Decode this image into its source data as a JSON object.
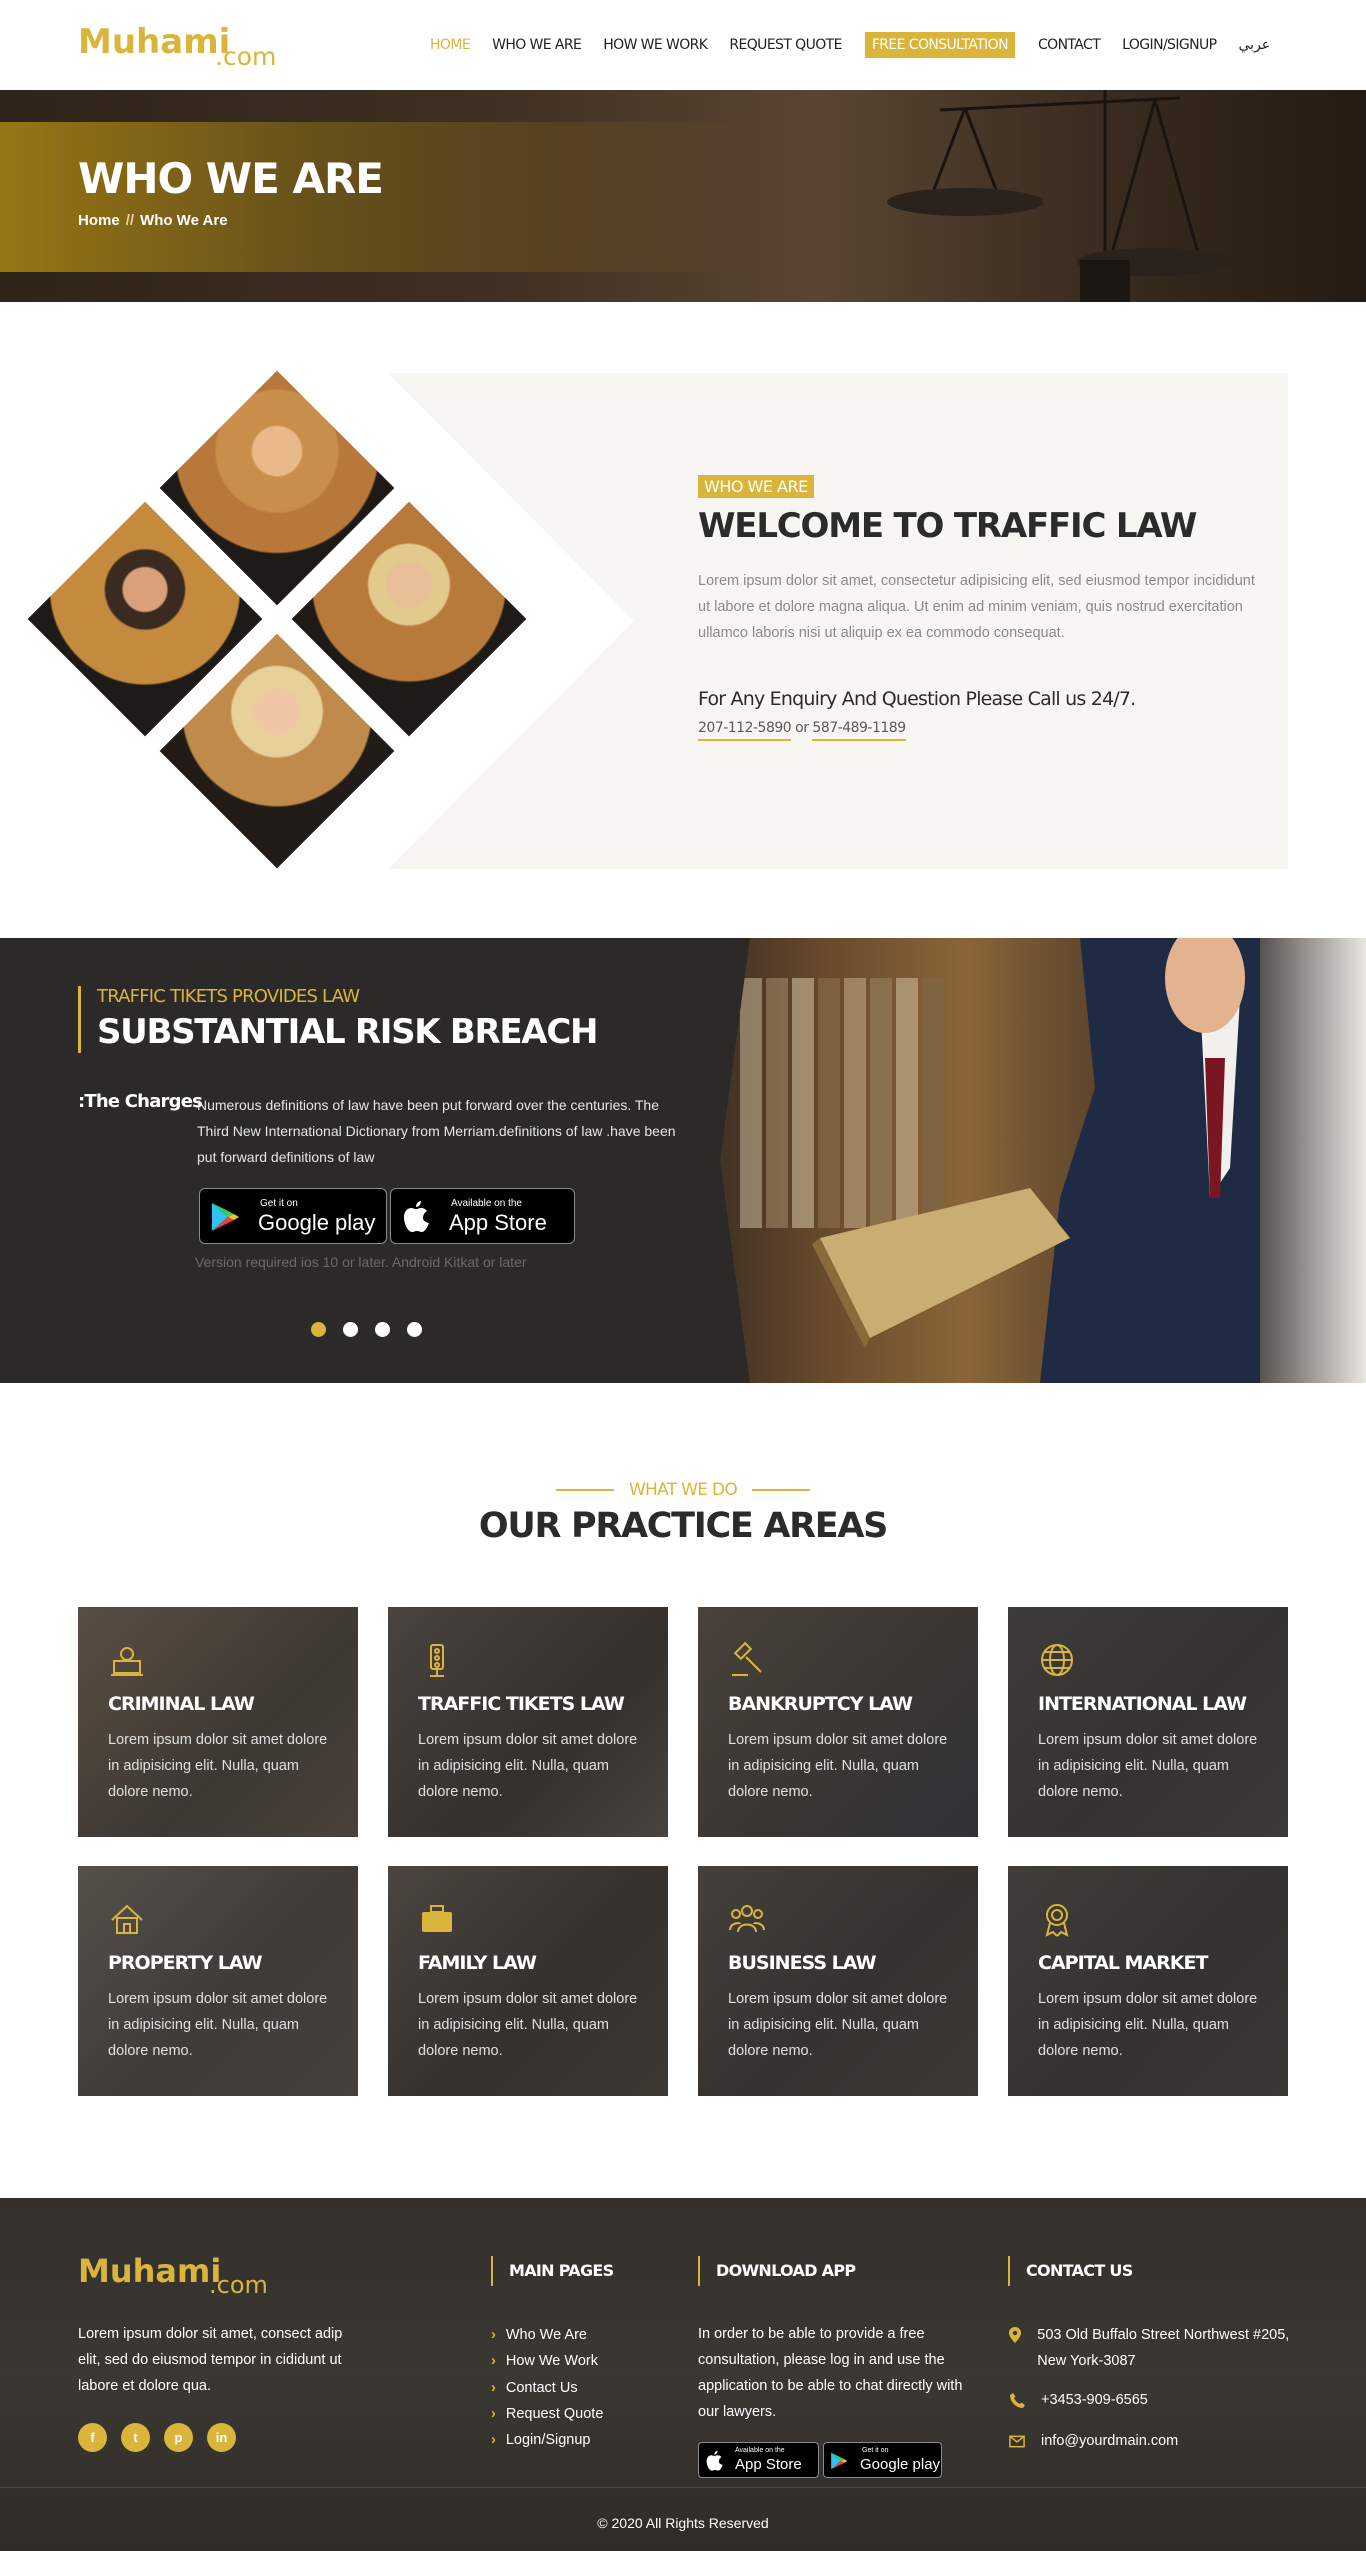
{
  "header": {
    "logo_brand": "Muhami",
    "logo_tld": ".com",
    "nav": [
      {
        "label": "HOME"
      },
      {
        "label": "WHO WE ARE"
      },
      {
        "label": "HOW WE WORK"
      },
      {
        "label": "REQUEST QUOTE"
      },
      {
        "label": "FREE CONSULTATION"
      },
      {
        "label": "CONTACT"
      },
      {
        "label": "LOGIN/SIGNUP"
      },
      {
        "label": "عربي"
      }
    ]
  },
  "hero": {
    "title": "WHO WE ARE",
    "crumb_home": "Home",
    "crumb_sep": "//",
    "crumb_current": "Who We Are"
  },
  "welcome": {
    "tag": "WHO WE ARE",
    "title": "WELCOME TO TRAFFIC LAW",
    "body": "Lorem ipsum dolor sit amet, consectetur adipisicing elit, sed eiusmod tempor incididunt ut labore et dolore magna aliqua. Ut enim ad minim veniam, quis nostrud exercitation ullamco laboris nisi ut aliquip ex ea commodo consequat.",
    "enquiry": "For Any Enquiry And Question Please Call us 24/7.",
    "phone1": "207-112-5890",
    "or": "or",
    "phone2": "587-489-1189"
  },
  "banner": {
    "subtitle": "TRAFFIC TIKETS PROVIDES LAW",
    "title": "SUBSTANTIAL RISK BREACH",
    "charges_title": ":The Charges",
    "charges_text": "Numerous definitions of law have been put forward over the centuries. The Third New International Dictionary from Merriam.definitions of law .have been put forward definitions of law",
    "google_small": "Get it on",
    "google_big": "Google play",
    "apple_small": "Available on the",
    "apple_big": "App Store",
    "note": "Version required ios 10 or later. Android Kitkat or later"
  },
  "practice": {
    "eyebrow": "WHAT WE DO",
    "title": "OUR PRACTICE AREAS",
    "cards": [
      {
        "title": "CRIMINAL LAW",
        "text": "Lorem ipsum dolor sit amet dolore in adipisicing elit. Nulla, quam dolore nemo.",
        "icon": "criminal-law-icon"
      },
      {
        "title": "TRAFFIC TIKETS LAW",
        "text": "Lorem ipsum dolor sit amet dolore in adipisicing elit. Nulla, quam dolore nemo.",
        "icon": "traffic-light-icon"
      },
      {
        "title": "BANKRUPTCY LAW",
        "text": "Lorem ipsum dolor sit amet dolore in adipisicing elit. Nulla, quam dolore nemo.",
        "icon": "gavel-icon"
      },
      {
        "title": "INTERNATIONAL LAW",
        "text": "Lorem ipsum dolor sit amet dolore in adipisicing elit. Nulla, quam dolore nemo.",
        "icon": "globe-icon"
      },
      {
        "title": "PROPERTY LAW",
        "text": "Lorem ipsum dolor sit amet dolore in adipisicing elit. Nulla, quam dolore nemo.",
        "icon": "house-icon"
      },
      {
        "title": "FAMILY LAW",
        "text": "Lorem ipsum dolor sit amet dolore in adipisicing elit. Nulla, quam dolore nemo.",
        "icon": "briefcase-icon"
      },
      {
        "title": "BUSINESS LAW",
        "text": "Lorem ipsum dolor sit amet dolore in adipisicing elit. Nulla, quam dolore nemo.",
        "icon": "team-icon"
      },
      {
        "title": "CAPITAL MARKET",
        "text": "Lorem ipsum dolor sit amet dolore in adipisicing elit. Nulla, quam dolore nemo.",
        "icon": "award-icon"
      }
    ]
  },
  "footer": {
    "logo_brand": "Muhami",
    "logo_tld": ".com",
    "about": "Lorem ipsum dolor sit amet, consect adip elit, sed do eiusmod tempor in cididunt ut labore et dolore qua.",
    "social": [
      "f",
      "t",
      "p",
      "in"
    ],
    "main_pages_title": "MAIN PAGES",
    "main_pages": [
      "Who We Are",
      "How We Work",
      "Contact Us",
      "Request Quote",
      "Login/Signup"
    ],
    "download_title": "DOWNLOAD APP",
    "download_text": "In order to be able to provide a free consultation, please log in and use the application to be able to chat directly with our lawyers.",
    "apple_small": "Available on the",
    "apple_big": "App Store",
    "google_small": "Get it on",
    "google_big": "Google play",
    "contact_title": "CONTACT US",
    "address": "503 Old Buffalo Street Northwest #205, New York-3087",
    "phone": "+3453-909-6565",
    "email": "info@yourdmain.com",
    "copyright": "© 2020 All Rights Reserved"
  },
  "colors": {
    "accent": "#d9b53c",
    "dark": "#2b2a28"
  }
}
